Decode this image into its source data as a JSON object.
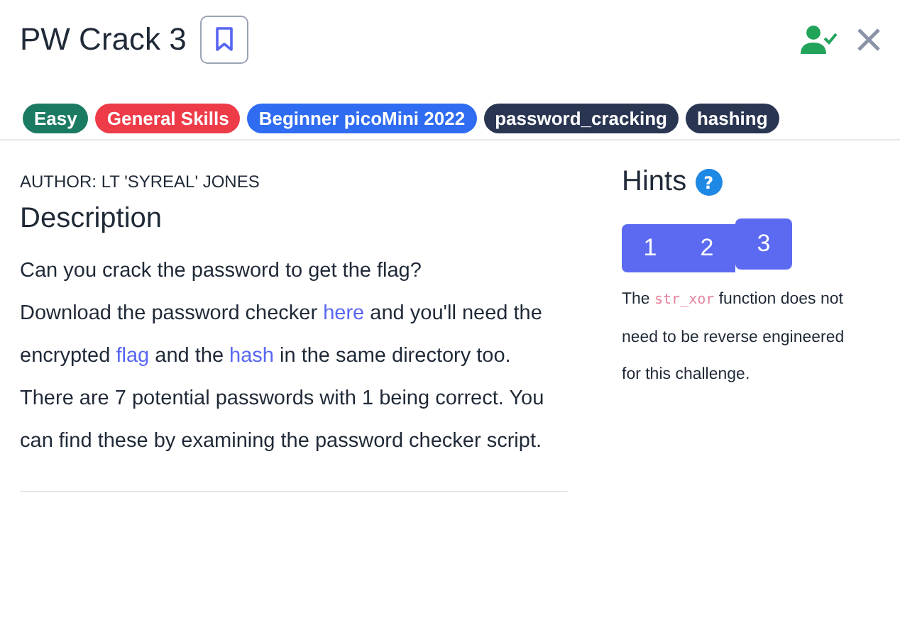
{
  "title": "PW Crack 3",
  "tags": [
    {
      "label": "Easy",
      "color": "#1b7a62"
    },
    {
      "label": "General Skills",
      "color": "#ee3b48"
    },
    {
      "label": "Beginner picoMini 2022",
      "color": "#2f6cf2"
    },
    {
      "label": "password_cracking",
      "color": "#2a3552"
    },
    {
      "label": "hashing",
      "color": "#2a3552"
    }
  ],
  "author": "AUTHOR: LT 'SYREAL' JONES",
  "description_heading": "Description",
  "paragraphs": [
    [
      {
        "kind": "text",
        "text": "Can you crack the password to get the flag?"
      }
    ],
    [
      {
        "kind": "text",
        "text": "Download the password checker "
      },
      {
        "kind": "link",
        "text": "here"
      },
      {
        "kind": "text",
        "text": " and you'll need the encrypted "
      },
      {
        "kind": "link",
        "text": "flag"
      },
      {
        "kind": "text",
        "text": " and the "
      },
      {
        "kind": "link",
        "text": "hash"
      },
      {
        "kind": "text",
        "text": " in the same directory too."
      }
    ],
    [
      {
        "kind": "text",
        "text": "There are 7 potential passwords with 1 being correct. You can find these by examining the password checker script."
      }
    ]
  ],
  "hints_heading": "Hints",
  "help_icon": "?",
  "hint_tabs": [
    {
      "label": "1",
      "selected": false
    },
    {
      "label": "2",
      "selected": false
    },
    {
      "label": "3",
      "selected": true
    }
  ],
  "hint": [
    {
      "kind": "text",
      "text": "The "
    },
    {
      "kind": "code",
      "text": "str_xor"
    },
    {
      "kind": "text",
      "text": " function does not need to be reverse engineered for this challenge."
    }
  ]
}
